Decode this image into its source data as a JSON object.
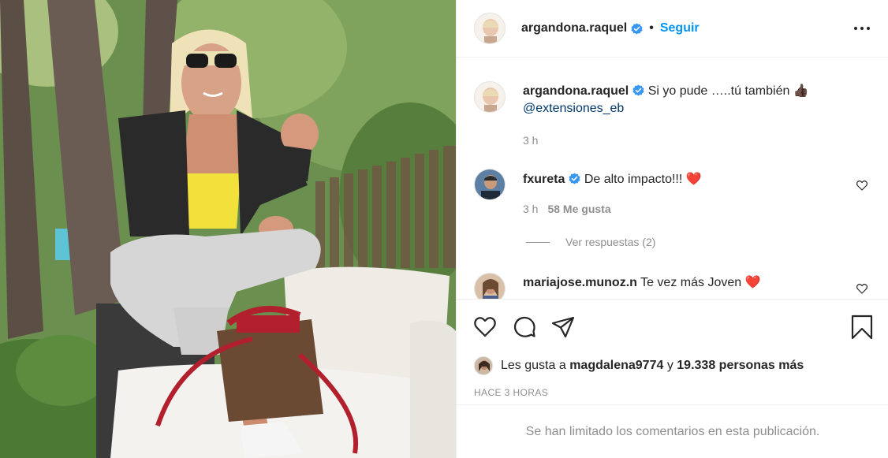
{
  "post": {
    "author": "argandona.raquel",
    "follow_label": "Seguir",
    "separator": "•"
  },
  "comments": [
    {
      "user": "argandona.raquel",
      "verified": true,
      "text": "Si yo pude …..tú también",
      "emoji": "👍🏿",
      "mention": "@extensiones_eb",
      "time": "3 h"
    },
    {
      "user": "fxureta",
      "verified": true,
      "text": "De alto impacto!!!",
      "emoji": "❤️",
      "time": "3 h",
      "likes": "58 Me gusta"
    },
    {
      "user": "mariajose.munoz.n",
      "verified": false,
      "text": "Te vez más Joven",
      "emoji": "❤️"
    }
  ],
  "replies_label": "Ver respuestas (2)",
  "likes": {
    "prefix": "Les gusta a",
    "first_user": "magdalena9774",
    "conjunction": "y",
    "others": "19.338 personas más"
  },
  "timestamp": "HACE 3 HORAS",
  "comments_limited": "Se han limitado los comentarios en esta publicación.",
  "colors": {
    "accent": "#0095f6",
    "verified": "#3897f0",
    "heart": "#ed4956",
    "mention": "#00376b",
    "muted": "#8e8e8e"
  },
  "icons": [
    "more-options-icon",
    "verified-icon",
    "heart-icon",
    "comment-icon",
    "share-icon",
    "bookmark-icon"
  ]
}
